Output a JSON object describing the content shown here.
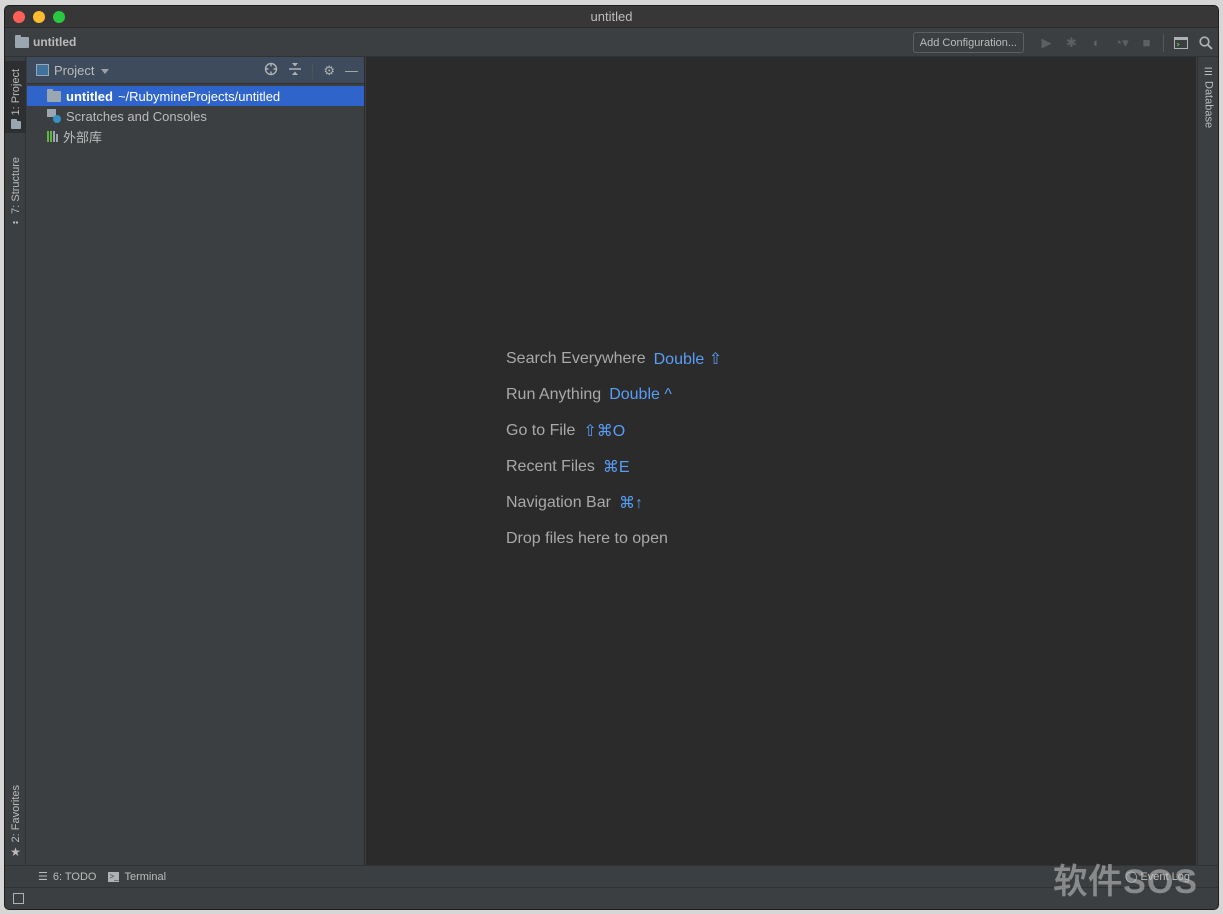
{
  "window": {
    "title": "untitled"
  },
  "navbar": {
    "breadcrumb": "untitled"
  },
  "toolbar": {
    "add_configuration": "Add Configuration...",
    "icons": [
      "run-icon",
      "debug-icon",
      "coverage-icon",
      "profile-icon",
      "stop-icon",
      "terminal-window-icon",
      "search-icon"
    ]
  },
  "left_strip": {
    "tabs": [
      {
        "label": "1: Project",
        "icon": "folder-icon"
      },
      {
        "label": "7: Structure",
        "icon": "structure-icon"
      },
      {
        "label": "2: Favorites",
        "icon": "star-icon"
      }
    ]
  },
  "right_strip": {
    "tabs": [
      {
        "label": "Database",
        "icon": "database-icon"
      }
    ]
  },
  "project_panel": {
    "title": "Project",
    "tree": [
      {
        "name": "untitled",
        "path": "~/RubymineProjects/untitled",
        "selected": true
      },
      {
        "name": "Scratches and Consoles"
      },
      {
        "name": "外部库"
      }
    ]
  },
  "editor": {
    "hints": [
      {
        "label": "Search Everywhere",
        "shortcut": "Double ⇧"
      },
      {
        "label": "Run Anything",
        "shortcut": "Double ^"
      },
      {
        "label": "Go to File",
        "shortcut": "⇧⌘O"
      },
      {
        "label": "Recent Files",
        "shortcut": "⌘E"
      },
      {
        "label": "Navigation Bar",
        "shortcut": "⌘↑"
      },
      {
        "label": "Drop files here to open",
        "shortcut": ""
      }
    ]
  },
  "bottom_bar": {
    "todo": "6: TODO",
    "terminal": "Terminal",
    "event_log": "Event Log"
  },
  "watermark": "软件SOS"
}
